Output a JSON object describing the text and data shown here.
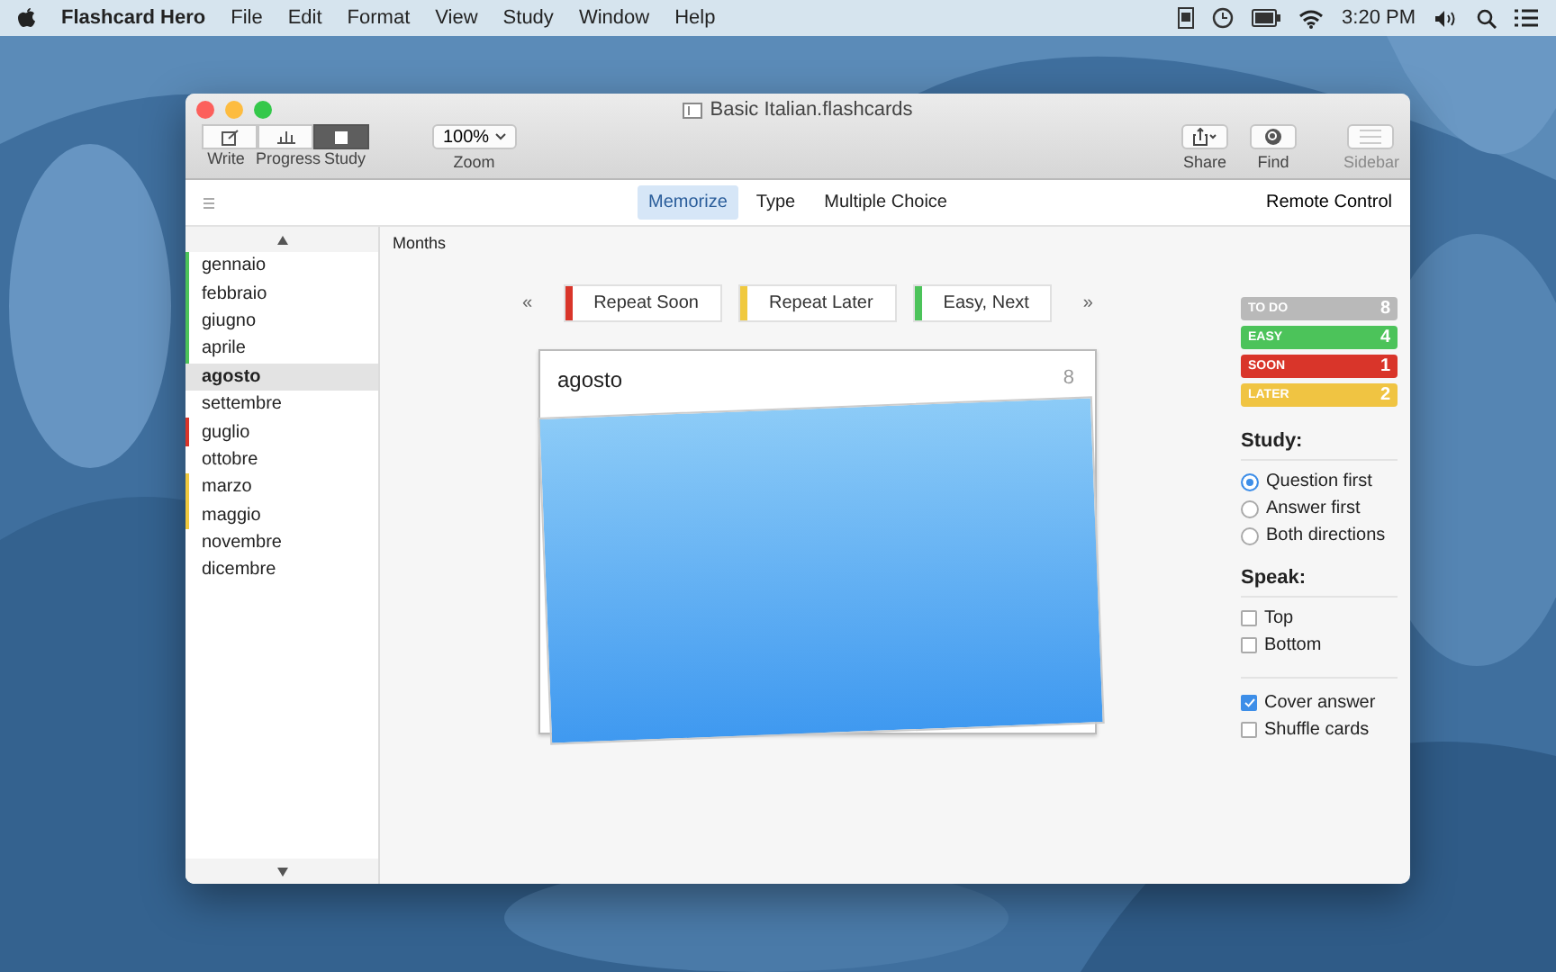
{
  "menubar": {
    "app": "Flashcard Hero",
    "menus": [
      "File",
      "Edit",
      "Format",
      "View",
      "Study",
      "Window",
      "Help"
    ],
    "clock": "3:20 PM"
  },
  "window": {
    "title": "Basic Italian.flashcards"
  },
  "toolbar": {
    "modes": [
      {
        "label": "Write",
        "selected": false
      },
      {
        "label": "Progress",
        "selected": false
      },
      {
        "label": "Study",
        "selected": true
      }
    ],
    "zoom": {
      "value": "100%",
      "label": "Zoom"
    },
    "share": "Share",
    "find": "Find",
    "sidebar": {
      "label": "Sidebar",
      "disabled": true
    }
  },
  "tabs": [
    {
      "label": "Memorize",
      "selected": true
    },
    {
      "label": "Type",
      "selected": false
    },
    {
      "label": "Multiple Choice",
      "selected": false
    }
  ],
  "remote_control": "Remote Control",
  "deck_list": [
    {
      "name": "gennaio",
      "selected": false,
      "color": "#4cc35a"
    },
    {
      "name": "febbraio",
      "selected": false,
      "color": "#4cc35a"
    },
    {
      "name": "giugno",
      "selected": false,
      "color": "#4cc35a"
    },
    {
      "name": "aprile",
      "selected": false,
      "color": "#4cc35a"
    },
    {
      "name": "agosto",
      "selected": true
    },
    {
      "name": "settembre",
      "selected": false
    },
    {
      "name": "guglio",
      "selected": false,
      "color": "#d9352a"
    },
    {
      "name": "ottobre",
      "selected": false
    },
    {
      "name": "marzo",
      "selected": false,
      "color": "#f0c93e"
    },
    {
      "name": "maggio",
      "selected": false,
      "color": "#f0c93e"
    },
    {
      "name": "novembre",
      "selected": false
    },
    {
      "name": "dicembre",
      "selected": false
    }
  ],
  "deck_title": "Months",
  "nav": {
    "prev": "«",
    "next": "»"
  },
  "answer_buttons": [
    {
      "label": "Repeat Soon",
      "color": "#d9352a"
    },
    {
      "label": "Repeat Later",
      "color": "#f0c93e"
    },
    {
      "label": "Easy, Next",
      "color": "#4cc35a"
    }
  ],
  "card": {
    "question": "agosto",
    "count": "8"
  },
  "stats": [
    {
      "label": "TO DO",
      "count": "8",
      "color": "#b9b9b9"
    },
    {
      "label": "EASY",
      "count": "4",
      "color": "#4cc35a"
    },
    {
      "label": "SOON",
      "count": "1",
      "color": "#d9352a"
    },
    {
      "label": "LATER",
      "count": "2",
      "color": "#f0c442"
    }
  ],
  "study": {
    "heading": "Study:",
    "options": [
      {
        "label": "Question first",
        "selected": true
      },
      {
        "label": "Answer first",
        "selected": false
      },
      {
        "label": "Both directions",
        "selected": false
      }
    ]
  },
  "speak": {
    "heading": "Speak:",
    "options": [
      {
        "label": "Top",
        "checked": false
      },
      {
        "label": "Bottom",
        "checked": false
      }
    ]
  },
  "extras": [
    {
      "label": "Cover answer",
      "checked": true
    },
    {
      "label": "Shuffle cards",
      "checked": false
    }
  ]
}
